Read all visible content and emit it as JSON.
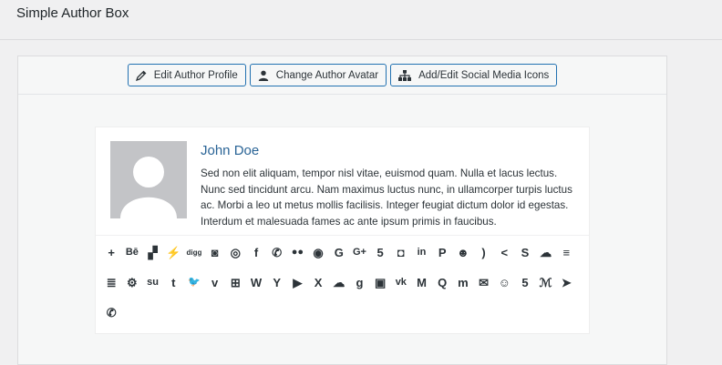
{
  "page": {
    "title": "Simple Author Box"
  },
  "toolbar": {
    "buttons": [
      {
        "label": "Edit Author Profile",
        "icon": "pencil-icon"
      },
      {
        "label": "Change Author Avatar",
        "icon": "user-icon"
      },
      {
        "label": "Add/Edit Social Media Icons",
        "icon": "sitemap-icon"
      }
    ]
  },
  "author": {
    "name": "John Doe",
    "bio": "Sed non elit aliquam, tempor nisl vitae, euismod quam. Nulla et lacus lectus. Nunc sed tincidunt arcu. Nam maximus luctus nunc, in ullamcorper turpis luctus ac. Morbi a leo ut metus mollis facilisis. Integer feugiat dictum dolor id egestas. Interdum et malesuada fames ac ante ipsum primis in faucibus."
  },
  "social_icons": [
    {
      "name": "addthis-icon",
      "glyph": "+"
    },
    {
      "name": "behance-icon",
      "glyph": "Bē"
    },
    {
      "name": "delicious-icon",
      "glyph": "▞"
    },
    {
      "name": "deviantart-icon",
      "glyph": "⚡"
    },
    {
      "name": "digg-icon",
      "glyph": "digg"
    },
    {
      "name": "discord-icon",
      "glyph": "◙"
    },
    {
      "name": "dribbble-icon",
      "glyph": "◎"
    },
    {
      "name": "facebook-icon",
      "glyph": "f"
    },
    {
      "name": "whatsapp-icon",
      "glyph": "✆"
    },
    {
      "name": "flickr-icon",
      "glyph": "●●"
    },
    {
      "name": "github-icon",
      "glyph": "◉"
    },
    {
      "name": "google-icon",
      "glyph": "G"
    },
    {
      "name": "googleplus-icon",
      "glyph": "G+"
    },
    {
      "name": "html5-icon",
      "glyph": "5"
    },
    {
      "name": "instagram-icon",
      "glyph": "◘"
    },
    {
      "name": "linkedin-icon",
      "glyph": "in"
    },
    {
      "name": "pinterest-icon",
      "glyph": "P"
    },
    {
      "name": "reddit-icon",
      "glyph": "☻"
    },
    {
      "name": "rss-icon",
      "glyph": ")"
    },
    {
      "name": "sharethis-icon",
      "glyph": "<"
    },
    {
      "name": "skype-icon",
      "glyph": "S"
    },
    {
      "name": "soundcloud-icon",
      "glyph": "☁"
    },
    {
      "name": "spotify-icon",
      "glyph": "≡"
    },
    {
      "name": "stackexchange-icon",
      "glyph": "≣"
    },
    {
      "name": "steam-icon",
      "glyph": "⚙"
    },
    {
      "name": "stumbleupon-icon",
      "glyph": "su"
    },
    {
      "name": "tumblr-icon",
      "glyph": "t"
    },
    {
      "name": "twitter-icon",
      "glyph": "🐦"
    },
    {
      "name": "vimeo-icon",
      "glyph": "v"
    },
    {
      "name": "windows-icon",
      "glyph": "⊞"
    },
    {
      "name": "wordpress-icon",
      "glyph": "W"
    },
    {
      "name": "yahoo-icon",
      "glyph": "Y"
    },
    {
      "name": "youtube-icon",
      "glyph": "▶"
    },
    {
      "name": "xing-icon",
      "glyph": "X"
    },
    {
      "name": "mixcloud-icon",
      "glyph": "☁"
    },
    {
      "name": "goodreads-icon",
      "glyph": "g"
    },
    {
      "name": "twitch-icon",
      "glyph": "▣"
    },
    {
      "name": "vk-icon",
      "glyph": "vk"
    },
    {
      "name": "medium-icon",
      "glyph": "M"
    },
    {
      "name": "quora-icon",
      "glyph": "Q"
    },
    {
      "name": "meetup-icon",
      "glyph": "m"
    },
    {
      "name": "email-icon",
      "glyph": "✉"
    },
    {
      "name": "snapchat-icon",
      "glyph": "☺"
    },
    {
      "name": "500px-icon",
      "glyph": "5"
    },
    {
      "name": "mastodon-icon",
      "glyph": "ℳ"
    },
    {
      "name": "telegram-icon",
      "glyph": "➤"
    },
    {
      "name": "phone-icon",
      "glyph": "✆"
    }
  ]
}
